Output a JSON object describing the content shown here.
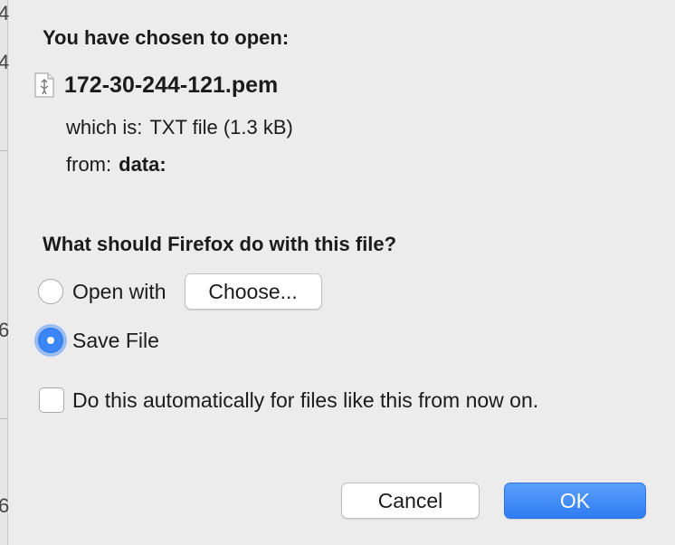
{
  "dialog": {
    "heading": "You have chosen to open:",
    "file_icon": "document-icon",
    "file_name": "172-30-244-121.pem",
    "which_is_label": "which is:",
    "which_is_value": "TXT file (1.3 kB)",
    "from_label": "from:",
    "from_value": "data:",
    "question": "What should Firefox do with this file?",
    "open_with_label": "Open with",
    "choose_button": "Choose...",
    "save_file_label": "Save File",
    "selected_option": "Save File",
    "auto_checkbox_label": "Do this automatically for files like this from now on.",
    "auto_checkbox_checked": false,
    "cancel_button": "Cancel",
    "ok_button": "OK"
  },
  "background_edge_glyphs": [
    "4",
    "4",
    "6",
    "6"
  ],
  "colors": {
    "background": "#ececec",
    "accent": "#3a86f7",
    "text": "#1b1b1b"
  }
}
